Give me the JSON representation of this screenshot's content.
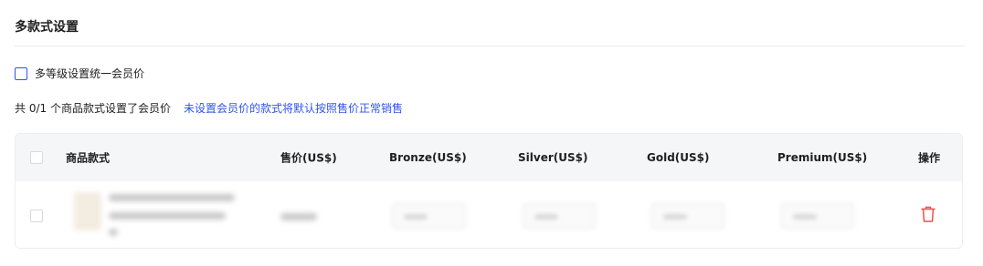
{
  "section": {
    "title": "多款式设置"
  },
  "option": {
    "label": "多等级设置统一会员价"
  },
  "summary": {
    "main": "共 0/1 个商品款式设置了会员价",
    "hint": "未设置会员价的款式将默认按照售价正常销售"
  },
  "table": {
    "headers": {
      "product": "商品款式",
      "price": "售价(US$)",
      "bronze": "Bronze(US$)",
      "silver": "Silver(US$)",
      "gold": "Gold(US$)",
      "premium": "Premium(US$)",
      "actions": "操作"
    }
  },
  "colors": {
    "accent": "#2f54eb",
    "danger": "#e5534b",
    "header_bg": "#f5f6f8"
  },
  "icons": {
    "delete": "trash-icon"
  }
}
